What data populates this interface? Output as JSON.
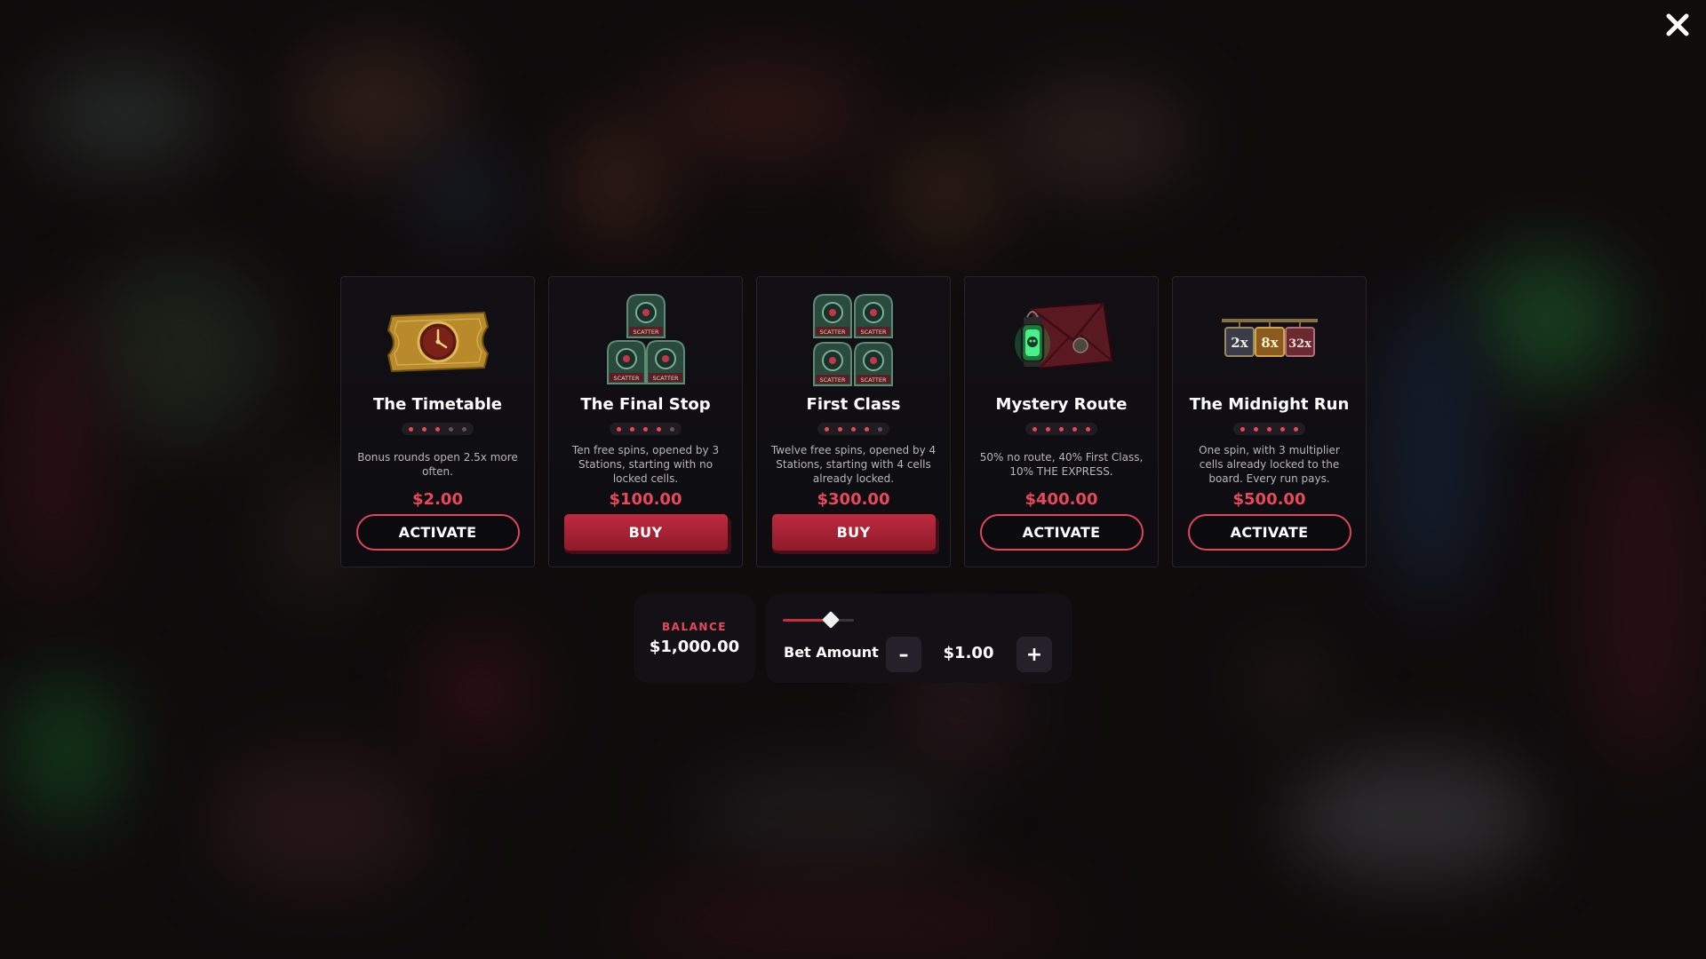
{
  "colors": {
    "accent": "#e8485b",
    "button_red": "#b8283c",
    "dot_active": "#e8485b",
    "dot_inactive": "#5a555e",
    "panel": "#131116"
  },
  "close": {
    "icon": "close-icon"
  },
  "cards": [
    {
      "title": "The Timetable",
      "rating": 3,
      "max_rating": 5,
      "description": "Bonus rounds open 2.5x more often.",
      "price": "$2.00",
      "button_label": "ACTIVATE",
      "button_style": "outline",
      "icon": "golden-ticket-clock-icon"
    },
    {
      "title": "The Final Stop",
      "rating": 4,
      "max_rating": 5,
      "description": "Ten free spins, opened by 3 Stations, starting with no locked cells.",
      "price": "$100.00",
      "button_label": "BUY",
      "button_style": "solid",
      "icon": "scatter-symbols-x3-icon",
      "scatter_text": "SCATTER"
    },
    {
      "title": "First Class",
      "rating": 4,
      "max_rating": 5,
      "description": "Twelve free spins, opened by 4 Stations, starting with 4 cells already locked.",
      "price": "$300.00",
      "button_label": "BUY",
      "button_style": "solid",
      "icon": "scatter-symbols-x4-icon",
      "scatter_text": "SCATTER"
    },
    {
      "title": "Mystery Route",
      "rating": 5,
      "max_rating": 5,
      "description": "50% no route, 40% First Class, 10% THE EXPRESS.",
      "price": "$400.00",
      "button_label": "ACTIVATE",
      "button_style": "outline",
      "icon": "mystery-envelope-lantern-icon"
    },
    {
      "title": "The Midnight Run",
      "rating": 5,
      "max_rating": 5,
      "description": "One spin, with 3 multiplier cells already locked to the board. Every run pays.",
      "price": "$500.00",
      "button_label": "ACTIVATE",
      "button_style": "outline",
      "icon": "multiplier-signs-icon",
      "multipliers": [
        "2x",
        "8x",
        "32x"
      ]
    }
  ],
  "balance": {
    "label": "BALANCE",
    "value": "$1,000.00"
  },
  "bet": {
    "label": "Bet Amount",
    "value": "$1.00",
    "minus_label": "–",
    "plus_label": "+",
    "slider_level": 0.68
  }
}
